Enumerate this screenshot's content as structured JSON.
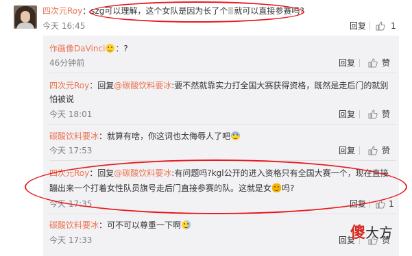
{
  "main_comment": {
    "username": "四次元Roy",
    "text_before": "：szg可以理解，这个女队是因为长了个",
    "text_after": "就可以直接参赛吗?",
    "time": "今天 16:45",
    "reply_label": "回复",
    "like_count": "1"
  },
  "replies": [
    {
      "username": "作画像DaVinci",
      "text": "：?",
      "time": "46分钟前",
      "reply_label": "回复",
      "like_label": "赞"
    },
    {
      "username": "四次元Roy",
      "prefix": "：回复",
      "mention": "@碳酸饮料要冰",
      "line1": ":要不然就靠实力打全国大赛获得资格，既然是走后门的就别",
      "line2": "怕被说",
      "time": "今天 18:01",
      "reply_label": "回复",
      "like_label": "赞"
    },
    {
      "username": "碳酸饮料要冰",
      "text": "：就算有啥，你这词也太侮辱人了吧",
      "time": "今天 17:53",
      "reply_label": "回复",
      "like_label": "赞"
    },
    {
      "username": "四次元Roy",
      "prefix": "：回复",
      "mention": "@碳酸饮料要冰",
      "line1": ":有问题吗?kgl公开的进入资格只有全国大赛一个，现在直接",
      "line2": "蹦出来一个打着女性队员旗号走后门直接参赛的队。这就是女",
      "line2_end": "吗?",
      "time": "今天 17:35",
      "reply_label": "回复",
      "like_count": "1"
    },
    {
      "username": "碳酸饮料要冰",
      "text": "：可不可以尊重一下啊",
      "time": "今天 17:33",
      "reply_label": "回复",
      "like_label": "赞"
    }
  ],
  "watermark": {
    "part1": "傻",
    "part2": "大方"
  },
  "colors": {
    "username": "#eb7350",
    "annotation": "#e8191f",
    "reply_bg": "#f2f2f5"
  }
}
